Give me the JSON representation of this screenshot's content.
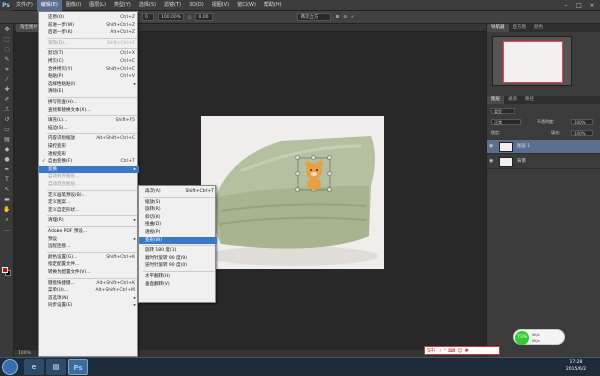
{
  "menubar": {
    "logo": "Ps",
    "items": [
      "文件(F)",
      "编辑(E)",
      "图像(I)",
      "图层(L)",
      "类型(Y)",
      "选择(S)",
      "滤镜(T)",
      "3D(D)",
      "视图(V)",
      "窗口(W)",
      "帮助(H)"
    ],
    "active_index": 1
  },
  "optbar": {
    "field1": "0",
    "field2": "100.00%",
    "zoom_label": "△",
    "field3": "0.00",
    "mode": "两次立方"
  },
  "tab": {
    "label": "淘宝图片..."
  },
  "edit_menu": {
    "items": [
      {
        "label": "还原(O)",
        "sc": "Ctrl+Z"
      },
      {
        "label": "前进一步(W)",
        "sc": "Shift+Ctrl+Z"
      },
      {
        "label": "后退一步(K)",
        "sc": "Alt+Ctrl+Z"
      },
      {
        "sep": true
      },
      {
        "label": "渐隐(D)...",
        "sc": "Shift+Ctrl+F",
        "dim": true
      },
      {
        "sep": true
      },
      {
        "label": "剪切(T)",
        "sc": "Ctrl+X"
      },
      {
        "label": "拷贝(C)",
        "sc": "Ctrl+C"
      },
      {
        "label": "合并拷贝(Y)",
        "sc": "Shift+Ctrl+C"
      },
      {
        "label": "粘贴(P)",
        "sc": "Ctrl+V"
      },
      {
        "label": "选择性粘贴(I)",
        "sub": true
      },
      {
        "label": "清除(E)"
      },
      {
        "sep": true
      },
      {
        "label": "拼写检查(H)..."
      },
      {
        "label": "查找和替换文本(X)..."
      },
      {
        "sep": true
      },
      {
        "label": "填充(L)...",
        "sc": "Shift+F5"
      },
      {
        "label": "描边(S)..."
      },
      {
        "sep": true
      },
      {
        "label": "内容识别缩放",
        "sc": "Alt+Shift+Ctrl+C"
      },
      {
        "label": "操控变形"
      },
      {
        "label": "透视变形"
      },
      {
        "label": "自由变换(F)",
        "sc": "Ctrl+T",
        "checked": true
      },
      {
        "label": "变换",
        "sub": true,
        "hl": true
      },
      {
        "label": "自动对齐图层...",
        "dim": true
      },
      {
        "label": "自动混合图层...",
        "dim": true
      },
      {
        "sep": true
      },
      {
        "label": "定义画笔预设(B)..."
      },
      {
        "label": "定义图案..."
      },
      {
        "label": "定义自定形状..."
      },
      {
        "sep": true
      },
      {
        "label": "清理(R)",
        "sub": true
      },
      {
        "sep": true
      },
      {
        "label": "Adobe PDF 预设..."
      },
      {
        "label": "预设",
        "sub": true
      },
      {
        "label": "远程连接..."
      },
      {
        "sep": true
      },
      {
        "label": "颜色设置(G)...",
        "sc": "Shift+Ctrl+K"
      },
      {
        "label": "指定配置文件..."
      },
      {
        "label": "转换为配置文件(V)..."
      },
      {
        "sep": true
      },
      {
        "label": "键盘快捷键...",
        "sc": "Alt+Shift+Ctrl+K"
      },
      {
        "label": "菜单(U)...",
        "sc": "Alt+Shift+Ctrl+M"
      },
      {
        "label": "首选项(N)",
        "sub": true
      },
      {
        "label": "同步设置(E)",
        "sub": true
      }
    ]
  },
  "transform_menu": {
    "items": [
      {
        "label": "再次(A)",
        "sc": "Shift+Ctrl+T"
      },
      {
        "sep": true
      },
      {
        "label": "缩放(S)"
      },
      {
        "label": "旋转(R)"
      },
      {
        "label": "斜切(K)"
      },
      {
        "label": "扭曲(D)"
      },
      {
        "label": "透视(P)"
      },
      {
        "label": "变形(W)",
        "hl": true
      },
      {
        "sep": true
      },
      {
        "label": "旋转 180 度(1)"
      },
      {
        "label": "顺时针旋转 90 度(9)"
      },
      {
        "label": "逆时针旋转 90 度(0)"
      },
      {
        "sep": true
      },
      {
        "label": "水平翻转(H)"
      },
      {
        "label": "垂直翻转(V)"
      }
    ]
  },
  "status": {
    "zoom": "100%"
  },
  "right_panel": {
    "nav_tabs": [
      "导航器",
      "直方图",
      "颜色"
    ],
    "layer_tabs": [
      "图层",
      "通道",
      "路径"
    ],
    "kind": "类型",
    "blend_mode": "正常",
    "opacity_label": "不透明度:",
    "opacity": "100%",
    "lock_label": "锁定:",
    "fill_label": "填充:",
    "fill": "100%",
    "layers": [
      {
        "name": "图层 1",
        "selected": true
      },
      {
        "name": "背景",
        "selected": false
      }
    ]
  },
  "float_widget": {
    "percent": "73%",
    "up": "0K/s",
    "down": "0K/s"
  },
  "ime": {
    "label": "S中"
  },
  "clock": {
    "time": "17:28",
    "date": "2015/6/2"
  },
  "colors": {
    "fg": "#e00000",
    "bg": "#000000",
    "accent": "#3b78c8"
  }
}
